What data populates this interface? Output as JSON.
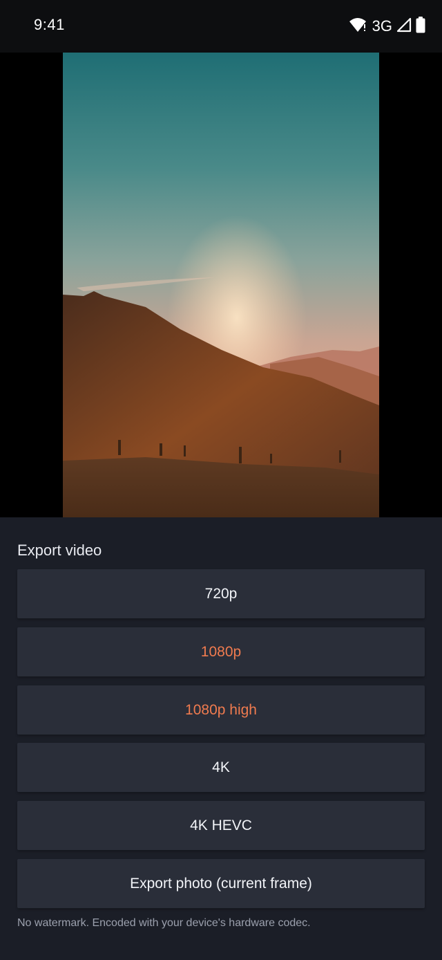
{
  "status_bar": {
    "time": "9:41",
    "network": "3G",
    "icons": [
      "wifi-icon",
      "signal-icon",
      "battery-icon"
    ]
  },
  "preview": {
    "description_icon": "video-preview"
  },
  "export_sheet": {
    "title": "Export video",
    "options": [
      {
        "label": "720p",
        "accent": false
      },
      {
        "label": "1080p",
        "accent": true
      },
      {
        "label": "1080p high",
        "accent": true
      },
      {
        "label": "4K",
        "accent": false
      },
      {
        "label": "4K HEVC",
        "accent": false
      },
      {
        "label": "Export photo (current frame)",
        "accent": false
      }
    ],
    "footer": "No watermark. Encoded with your device's hardware codec."
  },
  "colors": {
    "accent": "#f07b4f",
    "sheet_bg": "#1b1e27",
    "button_bg": "#2a2e39"
  }
}
